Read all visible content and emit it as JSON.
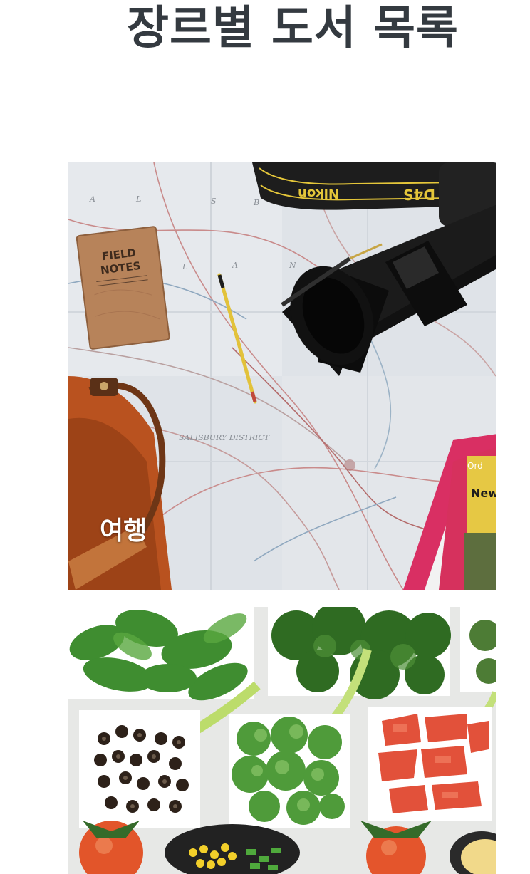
{
  "header": {
    "title": "장르별 도서 목록"
  },
  "genres": [
    {
      "label": "여행",
      "image_icon": "travel-photo-map-camera-notebook-bag"
    },
    {
      "label": "",
      "image_icon": "food-photo-salad-bowls"
    }
  ],
  "travel_photo_text": {
    "notebook": "FIELD NOTES",
    "strap": "Nikon D4S"
  },
  "colors": {
    "title": "#343a40",
    "label": "#ffffff"
  }
}
